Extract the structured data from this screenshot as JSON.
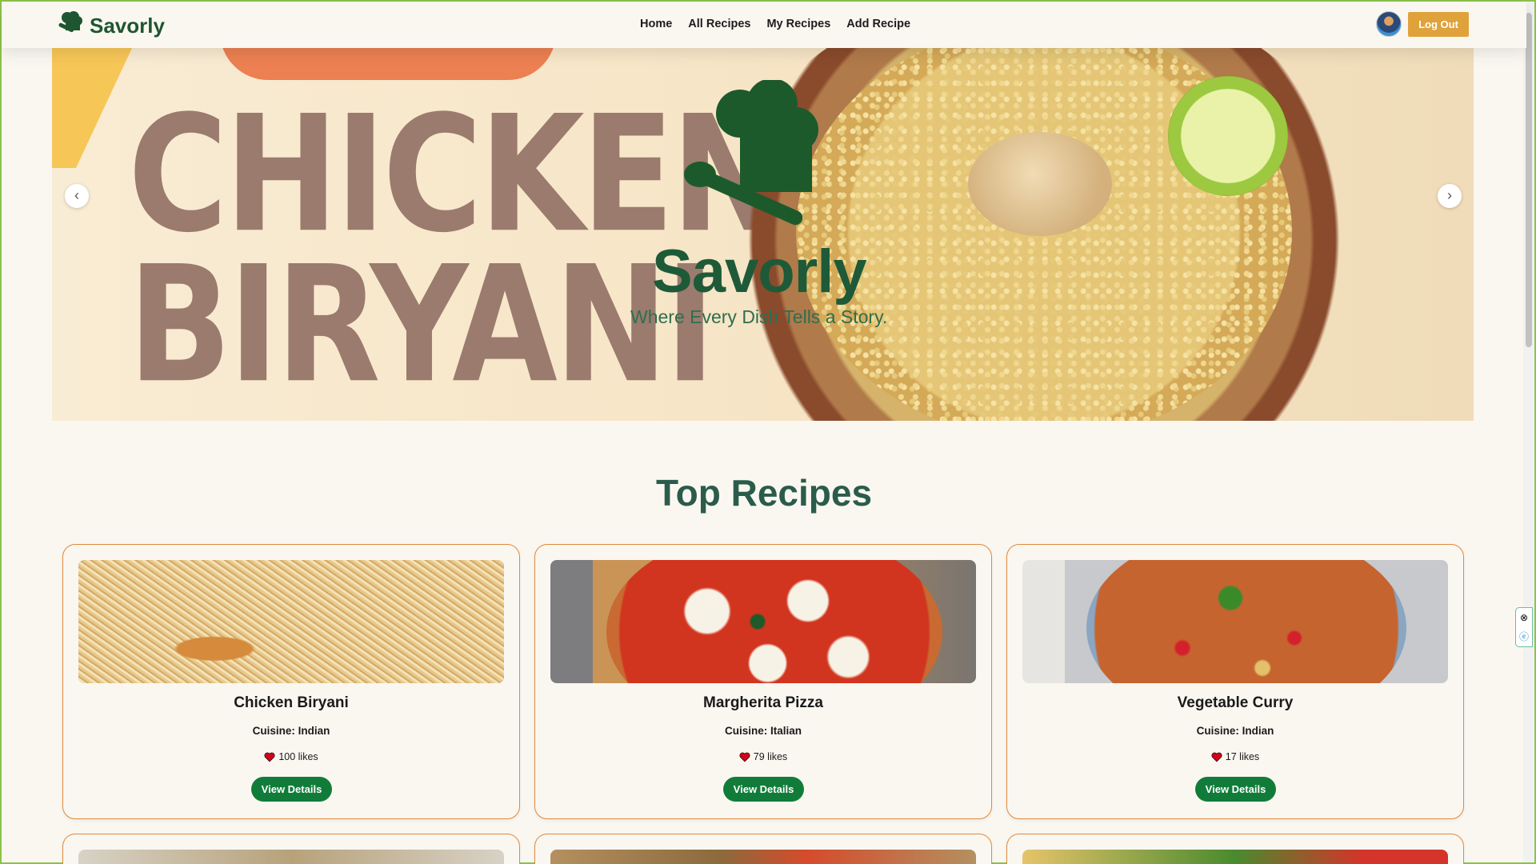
{
  "navbar": {
    "brand": "Savorly",
    "links": [
      "Home",
      "All Recipes",
      "My Recipes",
      "Add Recipe"
    ],
    "logout_label": "Log Out"
  },
  "hero": {
    "background_title_line1": "CHICKEN",
    "background_title_line2": "BIRYANI",
    "brand": "Savorly",
    "tagline": "Where Every Dish Tells a Story."
  },
  "section": {
    "title": "Top Recipes"
  },
  "recipes": [
    {
      "name": "Chicken Biryani",
      "cuisine": "Cuisine: Indian",
      "likes": "100 likes",
      "button": "View Details"
    },
    {
      "name": "Margherita Pizza",
      "cuisine": "Cuisine: Italian",
      "likes": "79 likes",
      "button": "View Details"
    },
    {
      "name": "Vegetable Curry",
      "cuisine": "Cuisine: Indian",
      "likes": "17 likes",
      "button": "View Details"
    }
  ],
  "colors": {
    "brand_green": "#1e5631",
    "accent_orange": "#e08a3c",
    "button_green": "#117c3a",
    "logout_gold": "#e0a23a",
    "heart_red": "#d0021b"
  },
  "icons": {
    "brand_logo": "chef-hat-spoon-icon",
    "like": "heart-icon",
    "prev": "chevron-left-icon",
    "next": "chevron-right-icon"
  }
}
